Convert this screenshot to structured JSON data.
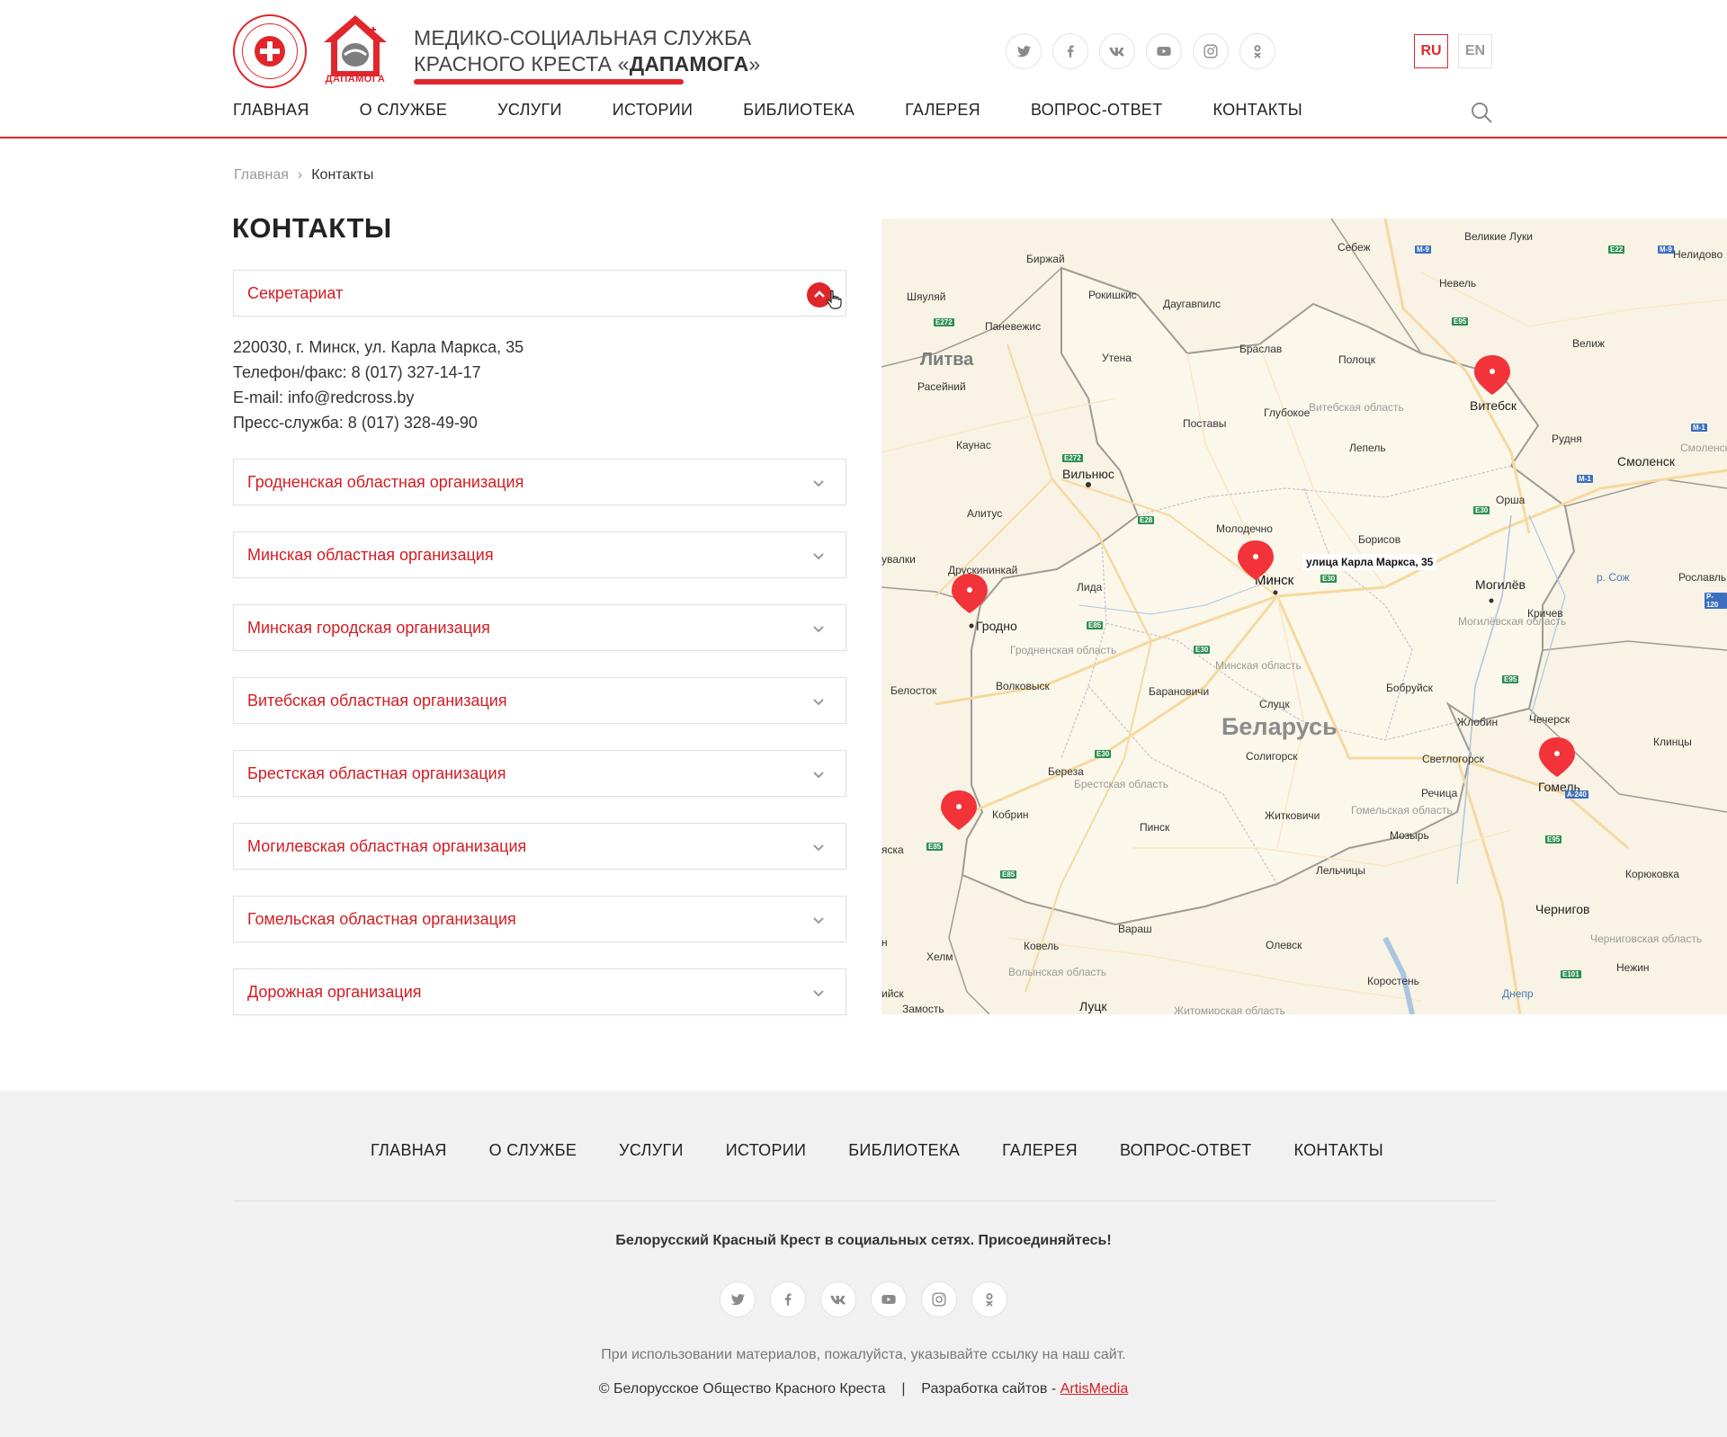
{
  "brand": {
    "line1": "МЕДИКО-СОЦИАЛЬНАЯ СЛУЖБА",
    "line2_prefix": "КРАСНОГО КРЕСТА «",
    "line2_strong": "ДАПАМОГА",
    "line2_suffix": "»",
    "house_label": "ДАПАМОГА",
    "accent_color": "#e1262b"
  },
  "social_icons": [
    "twitter-icon",
    "facebook-icon",
    "vk-icon",
    "youtube-icon",
    "instagram-icon",
    "odnoklassniki-icon"
  ],
  "languages": {
    "ru": "RU",
    "en": "EN",
    "active": "RU"
  },
  "nav": [
    "ГЛАВНАЯ",
    "О СЛУЖБЕ",
    "УСЛУГИ",
    "ИСТОРИИ",
    "БИБЛИОТЕКА",
    "ГАЛЕРЕЯ",
    "ВОПРОС-ОТВЕТ",
    "КОНТАКТЫ"
  ],
  "breadcrumb": {
    "home": "Главная",
    "separator": "›",
    "current": "Контакты"
  },
  "page_title": "КОНТАКТЫ",
  "secretariat": {
    "title": "Секретариат",
    "expanded": true,
    "address": "220030, г. Минск, ул. Карла Маркса, 35",
    "phone": "Телефон/факс: 8 (017) 327-14-17",
    "email": "E-mail: info@redcross.by",
    "press": "Пресс-служба: 8 (017) 328-49-90"
  },
  "organizations": [
    "Гродненская областная организация",
    "Минская областная организация",
    "Минская городская организация",
    "Витебская областная организация",
    "Брестская областная организация",
    "Могилевская областная организация",
    "Гомельская областная организация",
    "Дорожная организация"
  ],
  "map": {
    "country": "Беларусь",
    "lithuania": "Литва",
    "pin_label": "улица Карла Маркса, 35",
    "regions": [
      "Витебская область",
      "Гродненская область",
      "Минская область",
      "Могилёвская область",
      "Брестская область",
      "Гомельская область",
      "Волынская область",
      "Черниговская область",
      "Житомирская область",
      "Смоленская"
    ],
    "cities": [
      "Биржай",
      "Себеж",
      "Великие Луки",
      "Нелидово",
      "Шяуляй",
      "Рокишкис",
      "Даугавпилс",
      "Невель",
      "Паневежис",
      "Утена",
      "Браслав",
      "Полоцк",
      "Велиж",
      "Расейний",
      "Поставы",
      "Глубокое",
      "Витебск",
      "Каунас",
      "Лепель",
      "Рудня",
      "Смоленск",
      "Вильнюс",
      "Алитус",
      "Молодечно",
      "Орша",
      "Борисов",
      "Друскининкай",
      "Лида",
      "Минск",
      "Могилёв",
      "Гродно",
      "Кричев",
      "Рославль",
      "Белосток",
      "Волковыск",
      "Барановичи",
      "Бобруйск",
      "Слуцк",
      "Жлобин",
      "Чечерск",
      "Клинцы",
      "Солигорск",
      "Светлогорск",
      "Береза",
      "Гомель",
      "Кобрин",
      "Пинск",
      "Речица",
      "Житковичи",
      "Мозырь",
      "Лельчицы",
      "Корюковка",
      "Чернигов",
      "Вараш",
      "Ковель",
      "Хелм",
      "Олевск",
      "Нежин",
      "Коростень",
      "Замость",
      "Луцк",
      "увалки",
      "яска",
      "ийск",
      "н",
      "р. Сож",
      "Днепр"
    ],
    "roads": [
      "M-9",
      "E22",
      "M-9",
      "E272",
      "E95",
      "E272",
      "M-1",
      "E28",
      "M-1",
      "E30",
      "E85",
      "E30",
      "E30",
      "E95",
      "P-120",
      "E30",
      "E85",
      "A-240",
      "E95",
      "E101"
    ]
  },
  "footer": {
    "nav": [
      "ГЛАВНАЯ",
      "О СЛУЖБЕ",
      "УСЛУГИ",
      "ИСТОРИИ",
      "БИБЛИОТЕКА",
      "ГАЛЕРЕЯ",
      "ВОПРОС-ОТВЕТ",
      "КОНТАКТЫ"
    ],
    "join": "Белорусский Красный Крест в социальных сетях. Присоединяйтесь!",
    "note": "При использовании материалов, пожалуйста, указывайте ссылку на наш сайт.",
    "copyright": "© Белорусское Общество Красного Креста",
    "divider": "|",
    "dev_prefix": "Разработка сайтов -",
    "dev_link": "ArtisMedia"
  }
}
